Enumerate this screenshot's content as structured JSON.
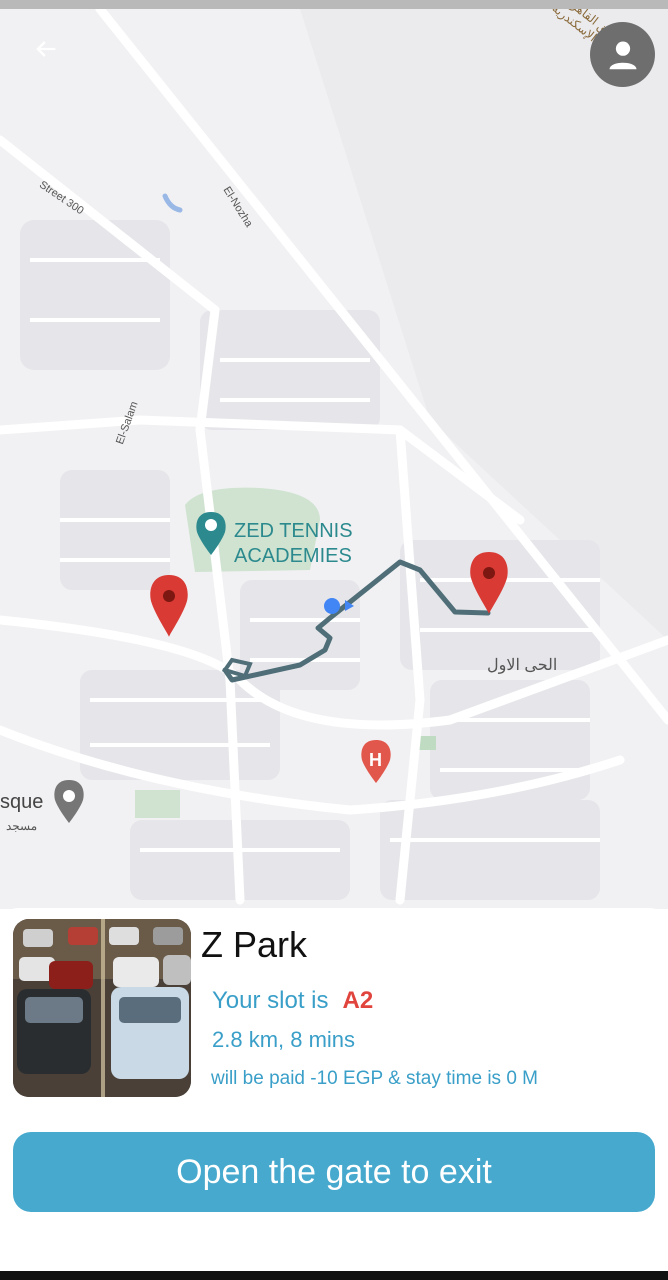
{
  "map": {
    "street_labels": [
      "Street 300",
      "El-Nozha",
      "El-Salam"
    ],
    "poi_label_line1": "ZED TENNIS",
    "poi_label_line2": "ACADEMIES",
    "district_label_ar": "الحى الاول",
    "mosque_label": "sque",
    "mosque_label_ar": "مسجد",
    "road_label_ar": "طريق القاهرة - الإسكندرية"
  },
  "header": {
    "back_icon": "arrow-left-icon",
    "profile_icon": "person-icon"
  },
  "parking": {
    "name": "Z Park",
    "slot_prefix": "Your slot is",
    "slot_code": "A2",
    "distance": "2.8 km, 8 mins",
    "payment_note": "will be paid -10 EGP & stay time is 0 M"
  },
  "actions": {
    "exit_label": "Open the gate to exit"
  },
  "colors": {
    "accent": "#46a9cd",
    "text_accent": "#3a9fc8",
    "slot_code": "#e0443c",
    "marker": "#d93a34",
    "route": "#4f6e78"
  }
}
